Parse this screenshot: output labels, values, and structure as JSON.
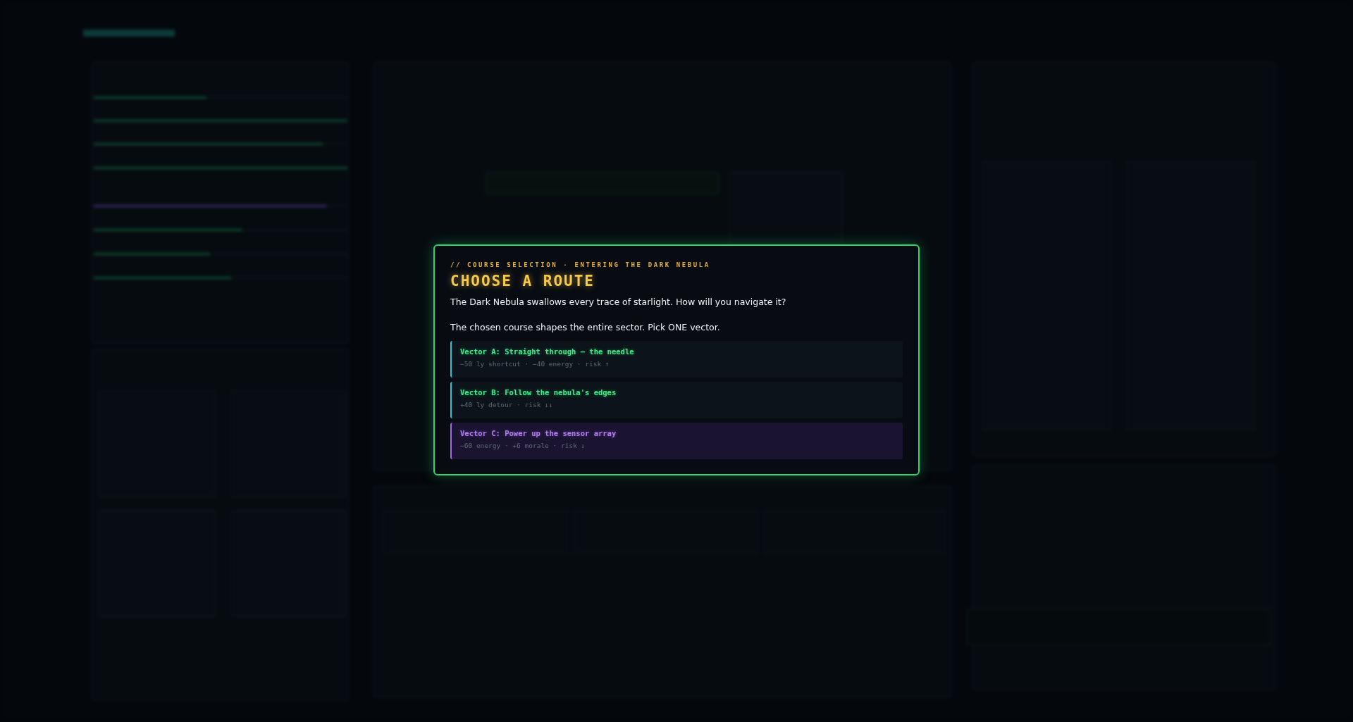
{
  "dialog": {
    "kicker": "// COURSE SELECTION · ENTERING THE DARK NEBULA",
    "title": "CHOOSE A ROUTE",
    "paragraphs": [
      "The Dark Nebula swallows every trace of starlight. How will you navigate it?",
      "The chosen course shapes the entire sector. Pick ONE vector."
    ],
    "options": [
      {
        "label": "Vector A: Straight through – the needle",
        "detail": "−50 ly shortcut · −40 energy · risk ↑",
        "kind": "standard"
      },
      {
        "label": "Vector B: Follow the nebula's edges",
        "detail": "+40 ly detour · risk ↓↓",
        "kind": "standard"
      },
      {
        "label": "Vector C: Power up the sensor array",
        "detail": "−60 energy · +6 morale · risk ↓",
        "kind": "special"
      }
    ]
  }
}
